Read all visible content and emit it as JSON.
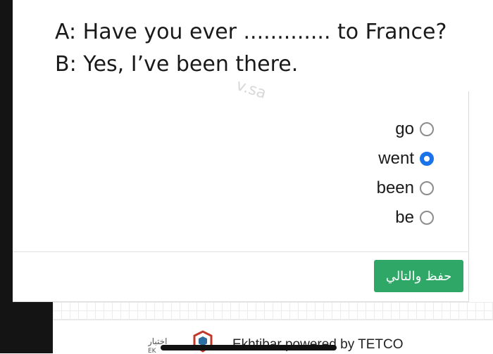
{
  "question": {
    "line_a": "A: Have you ever ............. to France?",
    "line_b": "B: Yes, I’ve been there.",
    "watermark": "v.sa"
  },
  "options": [
    {
      "label": "go",
      "checked": false
    },
    {
      "label": "went",
      "checked": true
    },
    {
      "label": "been",
      "checked": false
    },
    {
      "label": "be",
      "checked": false
    }
  ],
  "save_button": {
    "label": "حفظ والتالي"
  },
  "footer": {
    "text": "Ekhtibar powered by TETCO",
    "logo_text": "اختبار",
    "logo_sub": "EK"
  },
  "colors": {
    "accent": "#2fa867",
    "radio_selected": "#1a73e8"
  }
}
